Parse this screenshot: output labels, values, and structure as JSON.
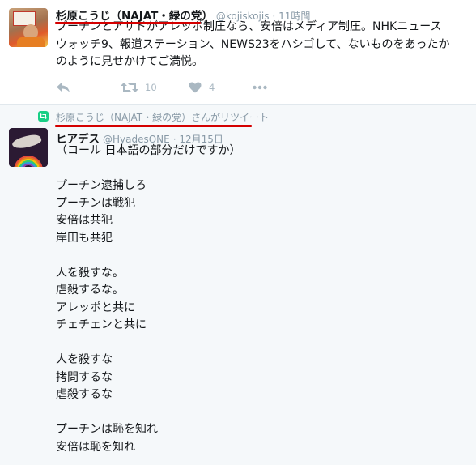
{
  "tweet1": {
    "name": "杉原こうじ（NAJAT・緑の党）",
    "handle": "@kojiskojis",
    "time": "· 11時間",
    "text_lines": [
      "プーチンとアサドがアレッポ制圧なら、安倍はメディア制圧。NHKニュース",
      "ウォッチ9、報道ステーション、NEWS23をハシゴして、ないものをあったか",
      "のように見せかけてご満悦。"
    ],
    "retweet_count": "10",
    "like_count": "4",
    "icons": [
      "reply-icon",
      "retweet-icon",
      "heart-icon",
      "more-icon"
    ]
  },
  "retweet_context": {
    "text": "杉原こうじ（NAJAT・緑の党）さんがリツイート"
  },
  "tweet2": {
    "name": "ヒアデス",
    "handle": "@HyadesONE",
    "time": "· 12月15日",
    "text_lines": [
      "（コール 日本語の部分だけですか）",
      "",
      "プーチン逮捕しろ",
      "プーチンは戦犯",
      "安倍は共犯",
      "岸田も共犯",
      "",
      "人を殺すな。",
      "虐殺するな。",
      "アレッポと共に",
      "チェチェンと共に",
      "",
      "人を殺すな",
      "拷問するな",
      "虐殺するな",
      "",
      "プーチンは恥を知れ",
      "安倍は恥を知れ"
    ]
  },
  "colors": {
    "annotation_underline": "#d40000",
    "retweet_badge": "#19cf86",
    "muted_text": "#8899a6",
    "action_icon": "#aab8c2"
  }
}
